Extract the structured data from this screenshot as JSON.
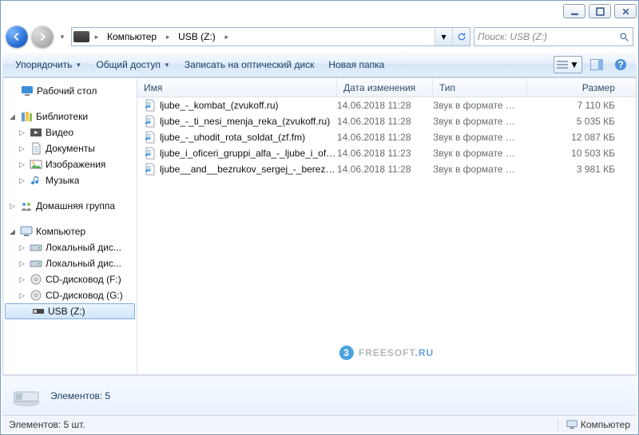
{
  "breadcrumb": {
    "seg1": "Компьютер",
    "seg2": "USB (Z:)"
  },
  "search": {
    "placeholder": "Поиск: USB (Z:)"
  },
  "toolbar": {
    "organize": "Упорядочить",
    "share": "Общий доступ",
    "burn": "Записать на оптический диск",
    "newfolder": "Новая папка"
  },
  "tree": {
    "desktop": "Рабочий стол",
    "libraries": "Библиотеки",
    "video": "Видео",
    "documents": "Документы",
    "pictures": "Изображения",
    "music": "Музыка",
    "homegroup": "Домашняя группа",
    "computer": "Компьютер",
    "localdisk1": "Локальный дис...",
    "localdisk2": "Локальный дис...",
    "cddrive1": "CD-дисковод (F:)",
    "cddrive2": "CD-дисковод (G:)",
    "usb": "USB (Z:)"
  },
  "columns": {
    "name": "Имя",
    "modified": "Дата изменения",
    "type": "Тип",
    "size": "Размер"
  },
  "files": [
    {
      "name": "ljube_-_kombat_(zvukoff.ru)",
      "date": "14.06.2018 11:28",
      "type": "Звук в формате …",
      "size": "7 110 КБ"
    },
    {
      "name": "ljube_-_ti_nesi_menja_reka_(zvukoff.ru)",
      "date": "14.06.2018 11:28",
      "type": "Звук в формате …",
      "size": "5 035 КБ"
    },
    {
      "name": "ljube_-_uhodit_rota_soldat_(zf.fm)",
      "date": "14.06.2018 11:28",
      "type": "Звук в формате …",
      "size": "12 087 КБ"
    },
    {
      "name": "ljube_i_oficeri_gruppi_alfa_-_ljube_i_ofice…",
      "date": "14.06.2018 11:23",
      "type": "Звук в формате …",
      "size": "10 503 КБ"
    },
    {
      "name": "ljube__and__bezrukov_sergej_-_berezi_(zv…",
      "date": "14.06.2018 11:28",
      "type": "Звук в формате …",
      "size": "3 981 КБ"
    }
  ],
  "details": {
    "count_label": "Элементов: 5"
  },
  "status": {
    "left": "Элементов: 5 шт.",
    "right": "Компьютер"
  },
  "watermark": {
    "brand": "FREESOFT",
    "tld": ".RU"
  }
}
